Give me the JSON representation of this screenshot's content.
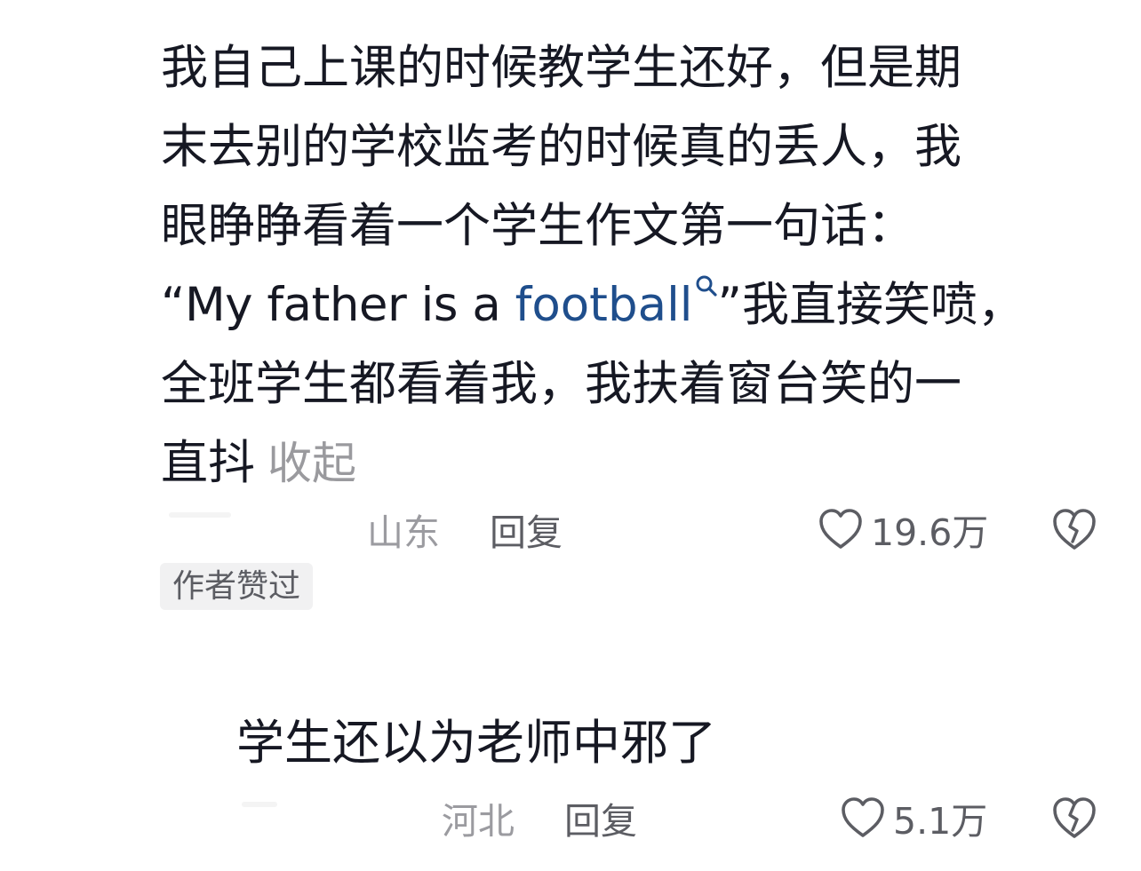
{
  "comment1": {
    "lines": [
      "我自己上课的时候教学生还好，但是期",
      "末去别的学校监考的时候真的丢人，我",
      "眼睁睁看着一个学生作文第一句话：",
      "",
      "全班学生都看着我，我扶着窗台笑的一",
      "直抖"
    ],
    "line4_prefix": "“My father is a ",
    "line4_link": "football",
    "line4_suffix": "”我直接笑喷，",
    "collapse_label": "收起",
    "location": "山东",
    "reply_label": "回复",
    "like_count": "19.6万",
    "author_badge": "作者赞过"
  },
  "comment2": {
    "text": "学生还以为老师中邪了",
    "location": "河北",
    "reply_label": "回复",
    "like_count": "5.1万"
  },
  "icons": {
    "like": "heart-outline-icon",
    "dislike": "broken-heart-icon",
    "search": "search-icon"
  },
  "colors": {
    "text": "#161823",
    "link": "#1f4e8c",
    "muted": "#9b9ba0",
    "secondary": "#5c5d63",
    "badge_bg": "#f1f1f2"
  }
}
